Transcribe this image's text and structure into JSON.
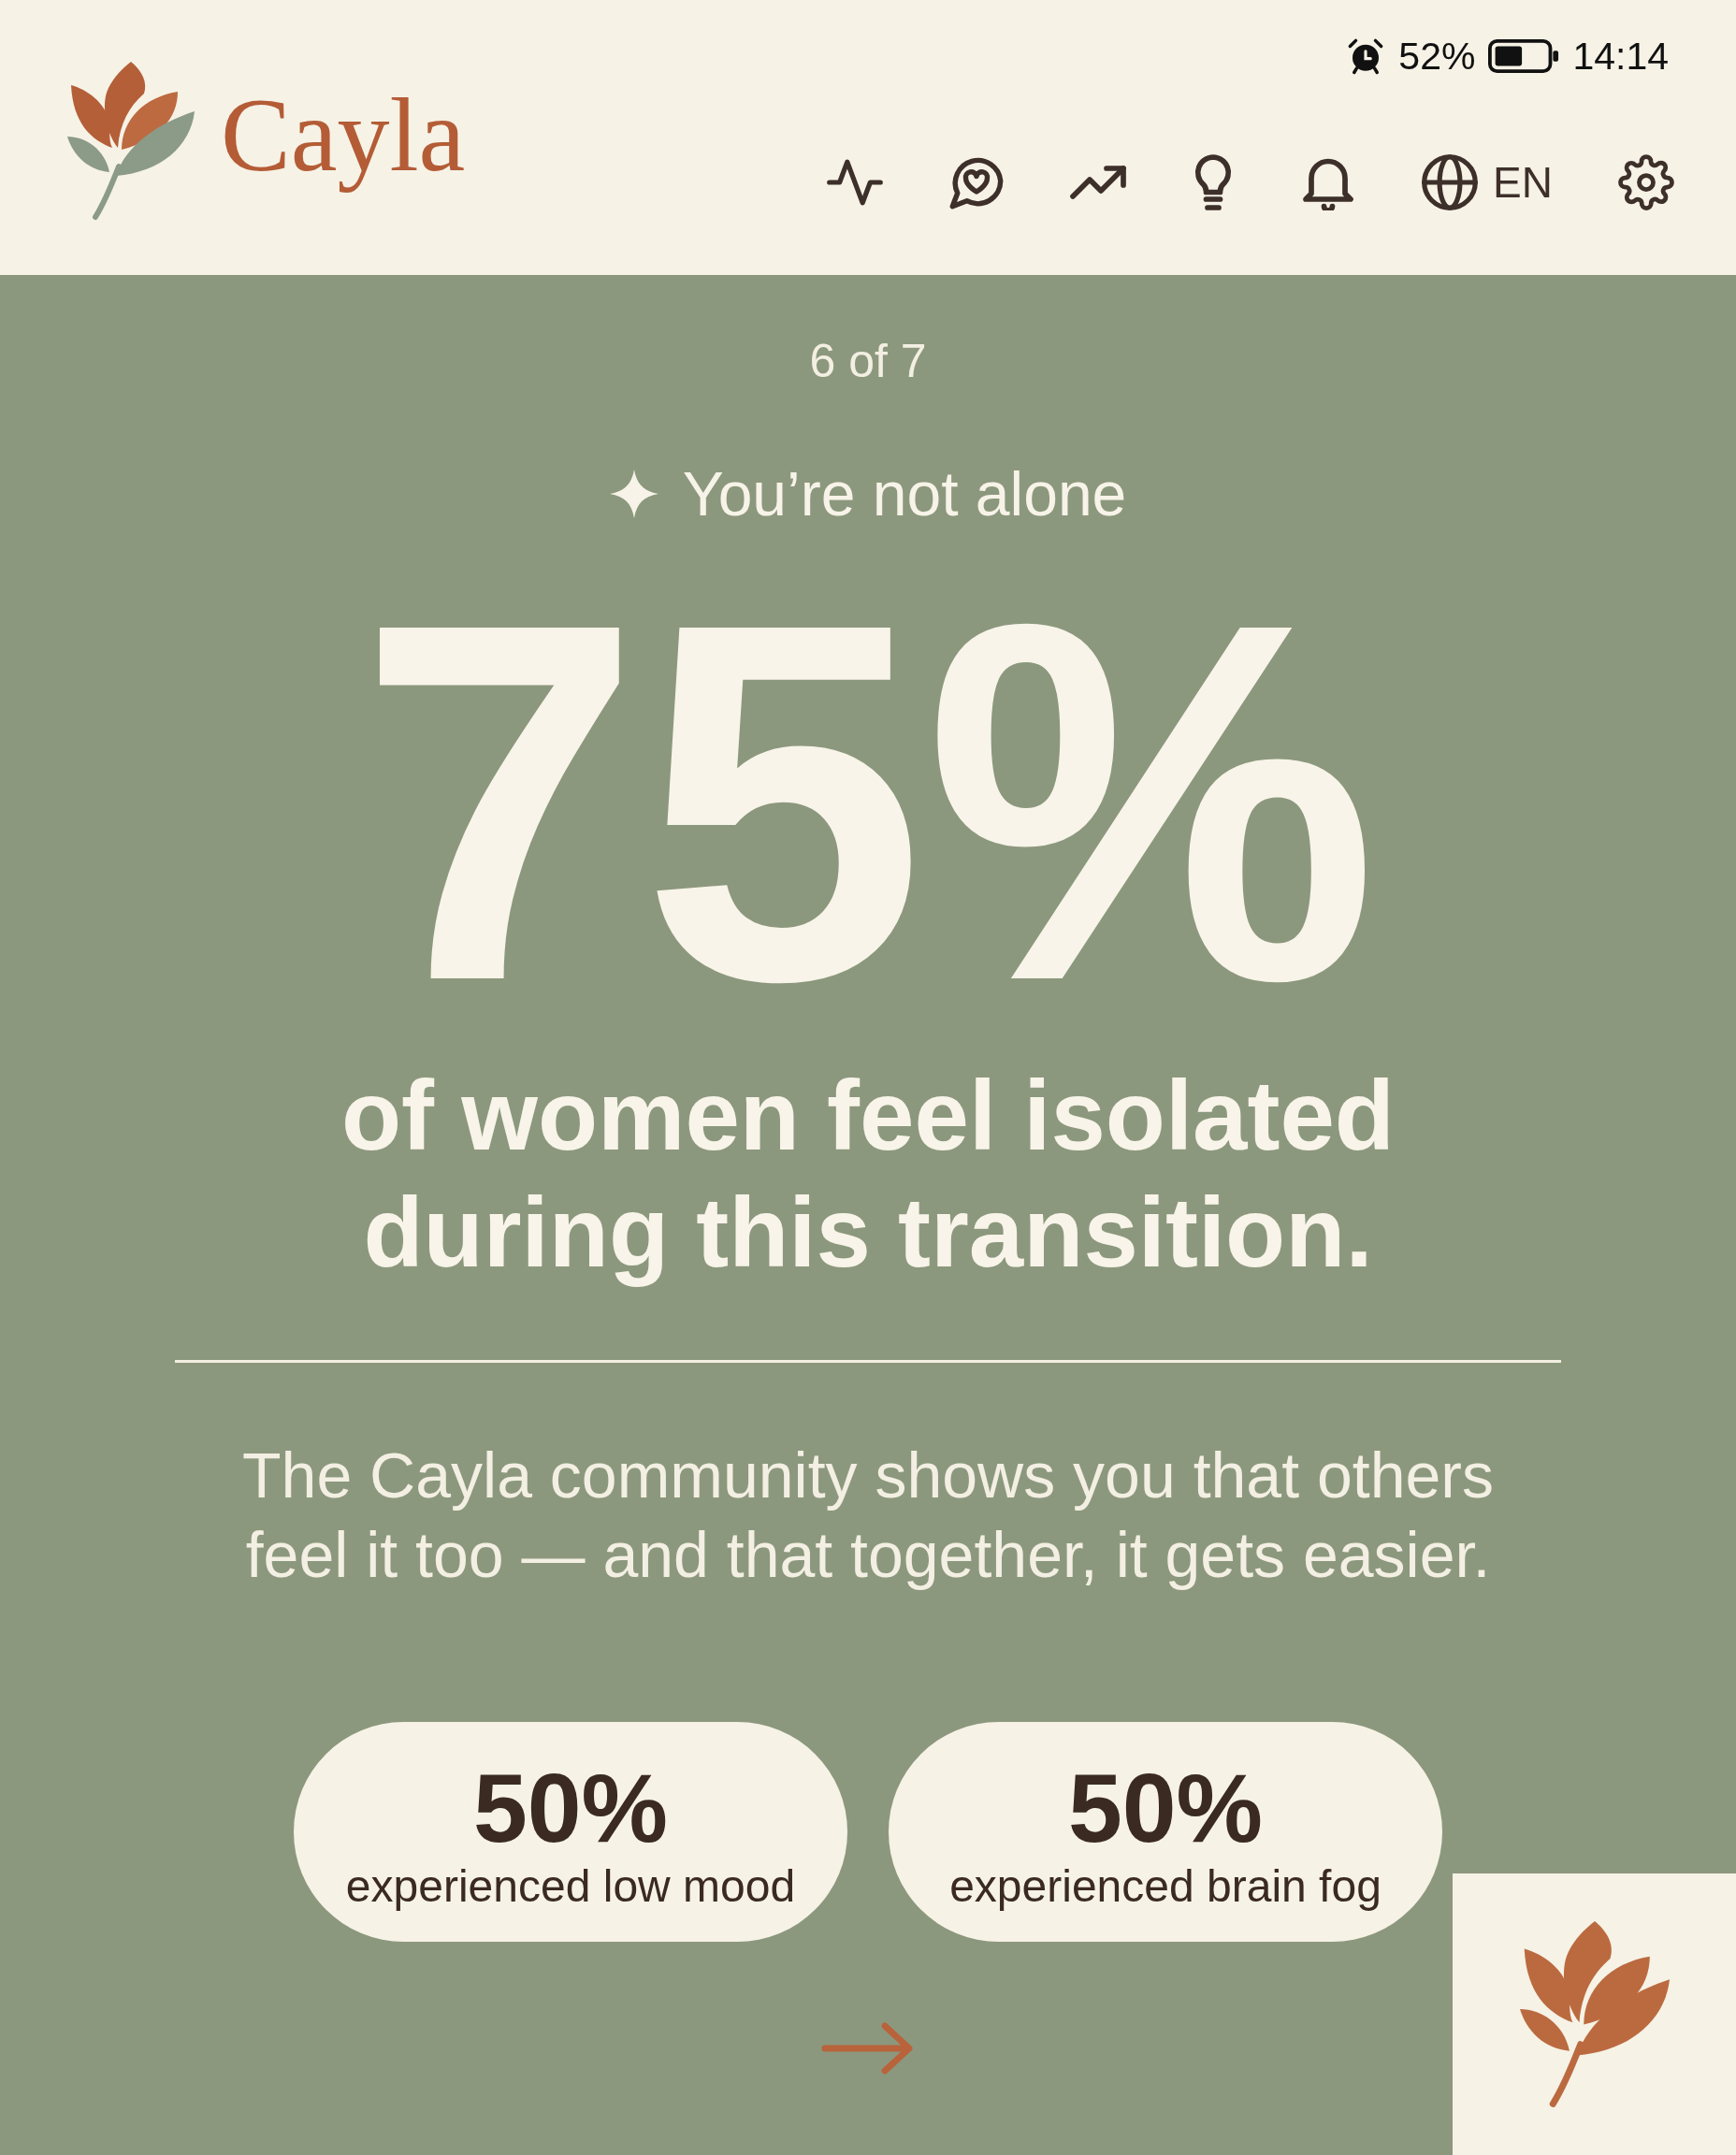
{
  "status_bar": {
    "battery_percent": "52%",
    "time": "14:14"
  },
  "header": {
    "logo_text": "Cayla",
    "language": "EN"
  },
  "slide": {
    "progress": "6 of 7",
    "eyebrow": "You’re not alone",
    "stat": "75%",
    "headline": "of women feel isolated during this transition.",
    "body": "The Cayla community shows you that others feel it too — and that together, it gets easier."
  },
  "stats": [
    {
      "value": "50%",
      "caption": "experienced low mood"
    },
    {
      "value": "50%",
      "caption": "experienced brain fog"
    }
  ]
}
